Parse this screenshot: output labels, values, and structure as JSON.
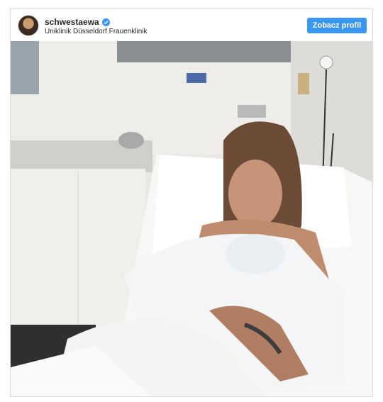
{
  "post": {
    "username": "schwestaewa",
    "location": "Uniklinik Düsseldorf Frauenklinik",
    "profile_button": "Zobacz profil",
    "verified_icon": "verified-badge-icon",
    "accent_color": "#3897f0"
  }
}
